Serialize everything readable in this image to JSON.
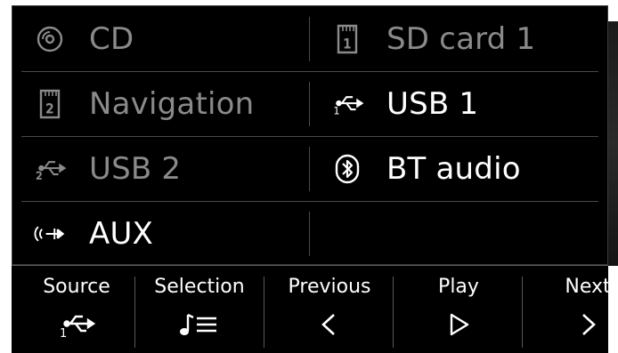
{
  "menu": {
    "items": [
      {
        "label": "CD",
        "icon": "cd-icon",
        "enabled": false
      },
      {
        "label": "SD card 1",
        "icon": "sd-card-1-icon",
        "enabled": false
      },
      {
        "label": "Navigation",
        "icon": "sd-card-2-icon",
        "enabled": false
      },
      {
        "label": "USB 1",
        "icon": "usb-1-icon",
        "enabled": true
      },
      {
        "label": "USB 2",
        "icon": "usb-2-icon",
        "enabled": false
      },
      {
        "label": "BT audio",
        "icon": "bluetooth-icon",
        "enabled": true
      },
      {
        "label": "AUX",
        "icon": "aux-icon",
        "enabled": true
      }
    ],
    "badges": {
      "sd1": "1",
      "sd2": "2",
      "usb1": "1",
      "usb2": "2"
    }
  },
  "toolbar": {
    "source_label": "Source",
    "selection_label": "Selection",
    "previous_label": "Previous",
    "play_label": "Play",
    "next_label": "Next",
    "source_badge": "1"
  },
  "colors": {
    "background": "#000000",
    "text_enabled": "#ffffff",
    "text_disabled": "#8a8a8a",
    "divider": "#4a4a4a"
  }
}
